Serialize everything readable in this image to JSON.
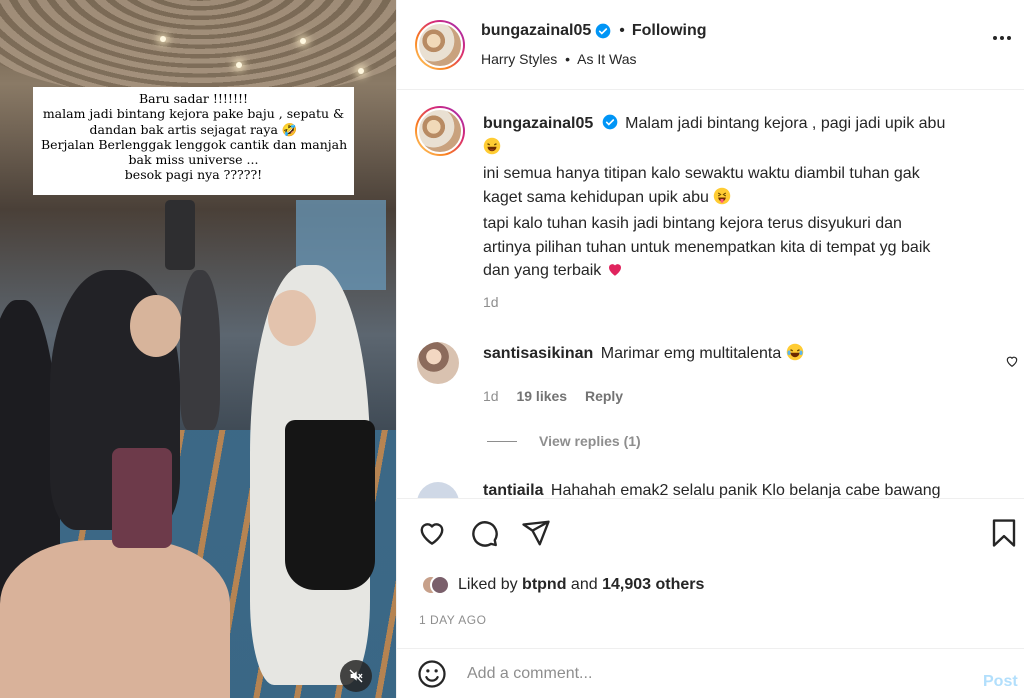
{
  "media": {
    "caption_lines": [
      "Baru sadar !!!!!!!",
      "malam jadi bintang kejora pake baju , sepatu &",
      "dandan bak artis sejagat raya 🤣",
      "Berjalan Berlenggak lenggok cantik dan manjah",
      "bak miss universe ...",
      "besok pagi nya ?????!"
    ]
  },
  "header": {
    "username": "bungazainal05",
    "follow_separator": "•",
    "follow_status": "Following",
    "audio_artist": "Harry Styles",
    "audio_separator": "•",
    "audio_title": "As It Was"
  },
  "post": {
    "username": "bungazainal05",
    "caption_first": "Malam jadi bintang kejora , pagi jadi upik abu",
    "caption_line2": "ini semua hanya titipan kalo sewaktu waktu diambil tuhan gak",
    "caption_line3": "kaget sama kehidupan upik abu",
    "caption_line4": "tapi kalo tuhan kasih jadi bintang kejora terus disyukuri dan",
    "caption_line5": "artinya pilihan tuhan untuk menempatkan kita di tempat yg baik",
    "caption_line6": "dan yang terbaik",
    "age": "1d"
  },
  "comments": [
    {
      "username": "santisasikinan",
      "text": "Marimar emg multitalenta",
      "age": "1d",
      "likes": "19 likes",
      "reply": "Reply",
      "view_replies": "View replies (1)"
    },
    {
      "username": "tantiaila",
      "text": "Hahahah emak2 selalu panik Klo belanja cabe bawang"
    }
  ],
  "likes": {
    "prefix": "Liked by",
    "user": "btpnd",
    "connector": "and",
    "others": "14,903 others"
  },
  "date": "1 DAY AGO",
  "add_comment": {
    "placeholder": "Add a comment...",
    "post_label": "Post"
  },
  "colors": {
    "verified": "#0095f6",
    "heart_emoji": "#e0245e",
    "post_disabled": "#b2dffc",
    "muted": "#8e8e8e"
  }
}
